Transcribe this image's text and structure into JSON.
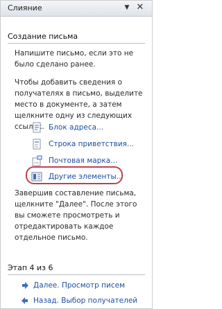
{
  "pane": {
    "title": "Слияние",
    "menu_glyph": "▼",
    "close_glyph": "✕"
  },
  "section": {
    "title": "Создание письма",
    "para1": "Напишите письмо, если это не было сделано ранее.",
    "para2": "Чтобы добавить сведения о получателях в письмо, выделите место в документе, а затем щелкните одну из следующих ссылок."
  },
  "links": [
    {
      "label": "Блок адреса...",
      "icon": "address-block-icon"
    },
    {
      "label": "Строка приветствия...",
      "icon": "greeting-line-icon"
    },
    {
      "label": "Почтовая марка...",
      "icon": "postage-icon"
    },
    {
      "label": "Другие элементы...",
      "icon": "more-items-icon"
    }
  ],
  "finish_text": "Завершив составление письма, щелкните \"Далее\". После этого вы сможете просмотреть и отредактировать каждое отдельное письмо.",
  "step": {
    "label": "Этап 4 из 6",
    "next": "Далее. Просмотр писем",
    "back": "Назад. Выбор получателей"
  },
  "colors": {
    "link": "#1f4fa3",
    "highlight": "#c0404c",
    "arrow": "#3a6fc4"
  }
}
